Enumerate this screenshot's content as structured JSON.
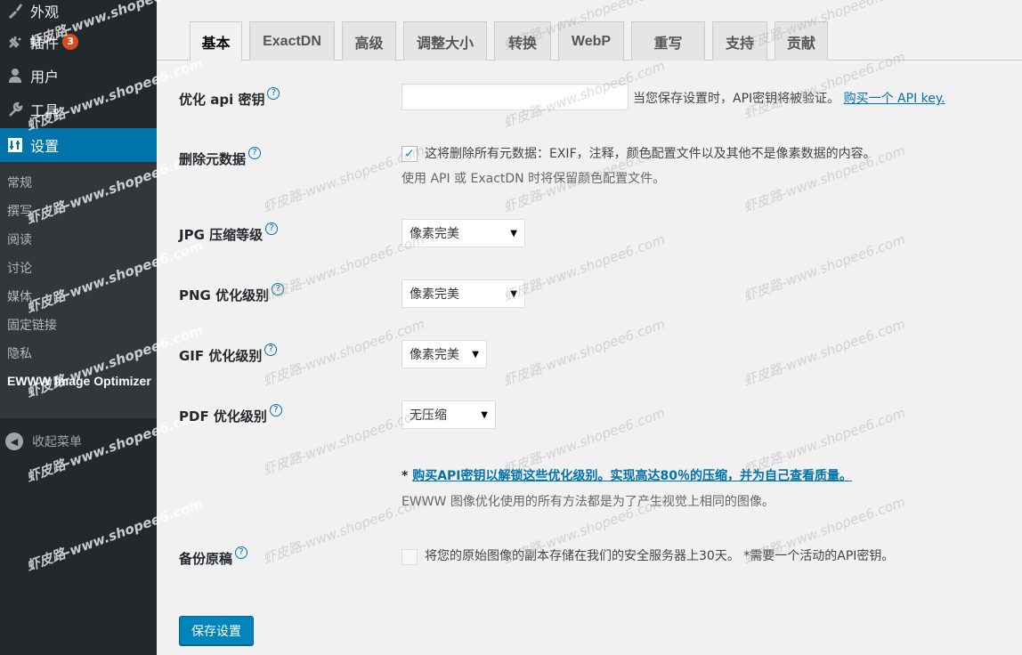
{
  "sidebar": {
    "items": [
      {
        "label": "外观",
        "icon": "brush-icon"
      },
      {
        "label": "插件",
        "icon": "plugin-icon",
        "badge": "3"
      },
      {
        "label": "用户",
        "icon": "user-icon"
      },
      {
        "label": "工具",
        "icon": "wrench-icon"
      }
    ],
    "current": {
      "label": "设置",
      "icon": "settings-icon"
    },
    "submenu": [
      "常规",
      "撰写",
      "阅读",
      "讨论",
      "媒体",
      "固定链接",
      "隐私"
    ],
    "submenu_active": "EWWW Image Optimizer",
    "collapse": "收起菜单"
  },
  "tabs": [
    "基本",
    "ExactDN",
    "高级",
    "调整大小",
    "转换",
    "WebP",
    "重写",
    "支持",
    "贡献"
  ],
  "form": {
    "api_key": {
      "label": "优化 api 密钥",
      "value": "",
      "desc": "当您保存设置时，API密钥将被验证。",
      "link": "购买一个 API key."
    },
    "metadata": {
      "label": "删除元数据",
      "checked": true,
      "desc": "这将删除所有元数据：EXIF，注释，颜色配置文件以及其他不是像素数据的内容。",
      "desc2": "使用 API 或 ExactDN 时将保留颜色配置文件。"
    },
    "jpg": {
      "label": "JPG 压缩等级",
      "value": "像素完美"
    },
    "png": {
      "label": "PNG 优化级别",
      "value": "像素完美"
    },
    "gif": {
      "label": "GIF 优化级别",
      "value": "像素完美"
    },
    "pdf": {
      "label": "PDF 优化级别",
      "value": "无压缩"
    },
    "upsell": {
      "prefix": "* ",
      "link": "购买API密钥以解锁这些优化级别。实现高达80％的压缩，并为自己查看质量。",
      "note": "EWWW 图像优化使用的所有方法都是为了产生视觉上相同的图像。"
    },
    "backup": {
      "label": "备份原稿",
      "checked": false,
      "desc": "将您的原始图像的副本存储在我们的安全服务器上30天。 *需要一个活动的API密钥。"
    },
    "help_glyph": "?",
    "save_label": "保存设置"
  },
  "watermark": "虾皮路-www.shopee6.com",
  "colors": {
    "sidebar_bg": "#23282d",
    "accent": "#0073aa",
    "badge": "#d54e21",
    "button": "#0085ba"
  }
}
